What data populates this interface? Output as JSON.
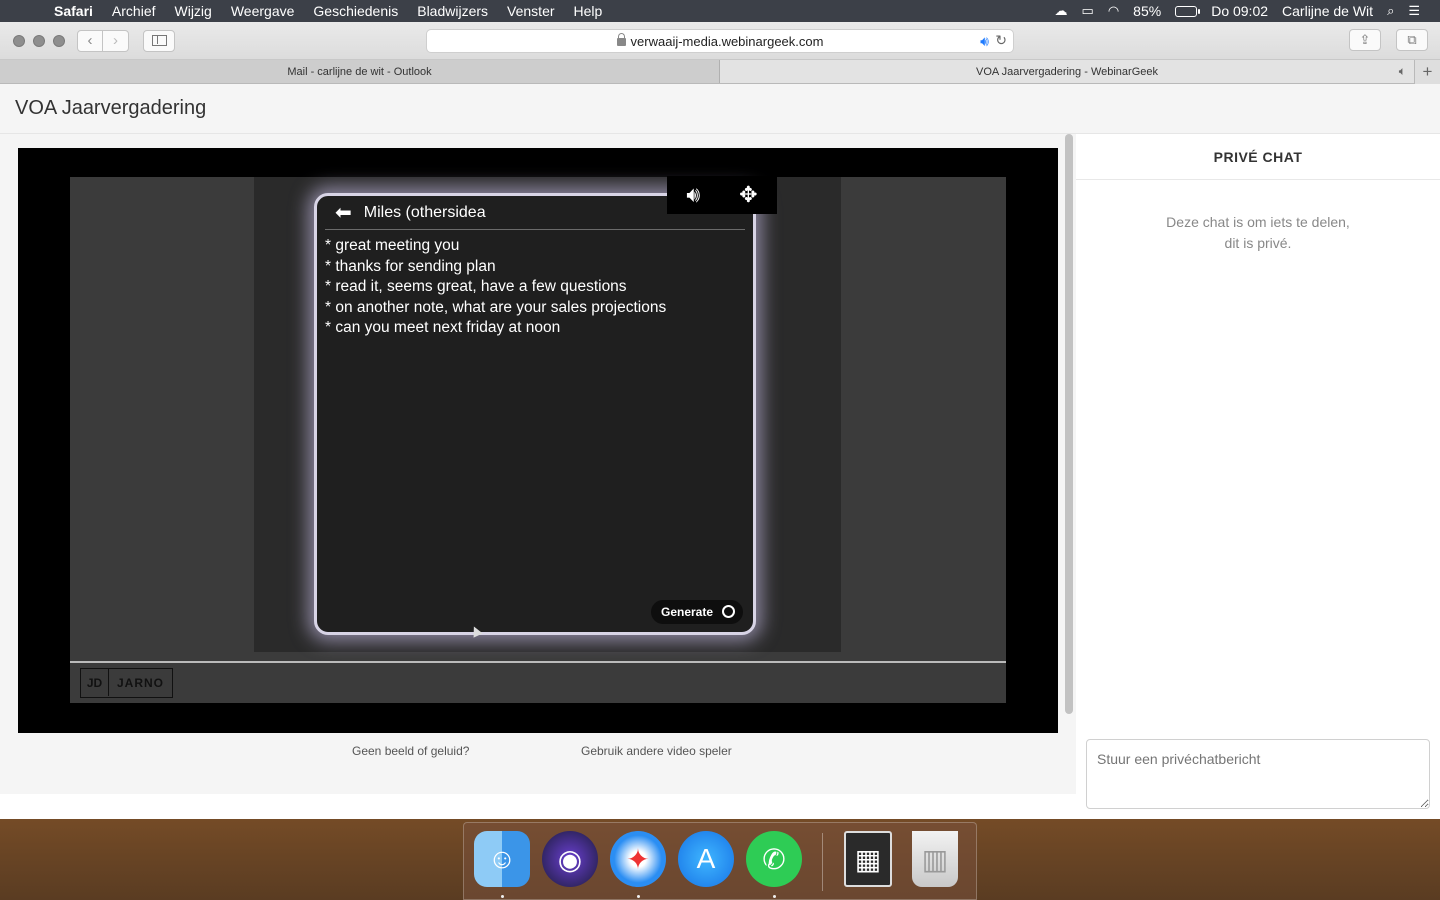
{
  "menubar": {
    "app": "Safari",
    "items": [
      "Archief",
      "Wijzig",
      "Weergave",
      "Geschiedenis",
      "Bladwijzers",
      "Venster",
      "Help"
    ],
    "battery": "85%",
    "clock": "Do 09:02",
    "user": "Carlijne de Wit"
  },
  "browser": {
    "url": "verwaaij-media.webinargeek.com",
    "tabs": [
      {
        "label": "Mail - carlijne de wit - Outlook",
        "active": false
      },
      {
        "label": "VOA Jaarvergadering - WebinarGeek",
        "active": true
      }
    ]
  },
  "page": {
    "title": "VOA Jaarvergadering",
    "links": {
      "no_signal": "Geen beeld of geluid?",
      "other_player": "Gebruik andere video speler"
    }
  },
  "video": {
    "chat_contact": "Miles (othersidea",
    "lines": [
      "* great meeting you",
      "* thanks for sending plan",
      "* read it, seems great, have a few questions",
      "* on another note, what are your sales projections",
      "* can you meet next friday at noon"
    ],
    "generate_label": "Generate",
    "logo_mark": "JD",
    "logo_name": "JARNO"
  },
  "chat": {
    "title": "PRIVÉ CHAT",
    "desc_line1": "Deze chat is om iets te delen,",
    "desc_line2": "dit is privé.",
    "placeholder": "Stuur een privéchatbericht"
  },
  "dock": {
    "apps": [
      "finder-icon",
      "siri-icon",
      "safari-icon",
      "app-store-icon",
      "whatsapp-icon",
      "photo-stack-icon",
      "trash-icon"
    ]
  }
}
